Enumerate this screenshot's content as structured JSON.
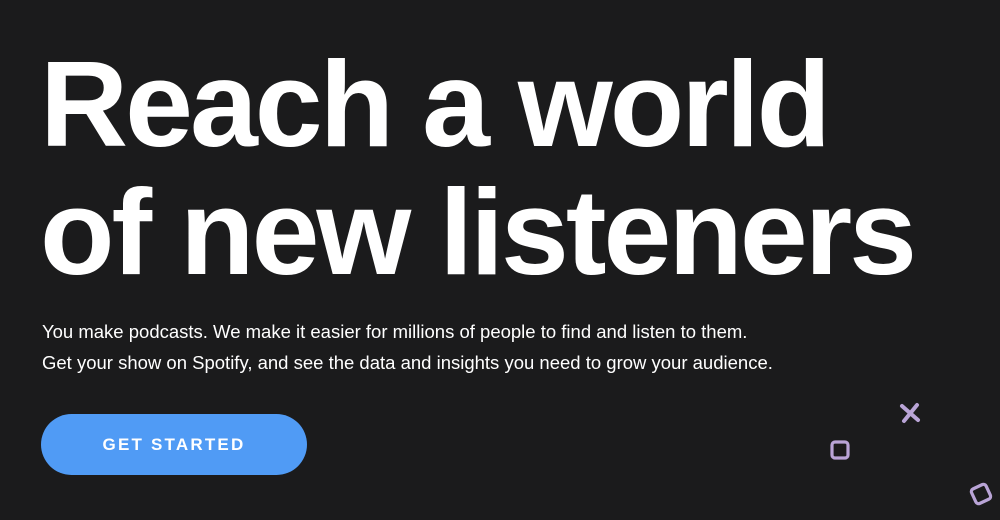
{
  "hero": {
    "headline_line1": "Reach a world",
    "headline_line2": "of new listeners",
    "subtext_line1": "You make podcasts. We make it easier for millions of people to find and listen to them.",
    "subtext_line2": "Get your show on Spotify, and see the data and insights you need to grow your audience.",
    "cta_label": "GET STARTED"
  },
  "colors": {
    "background": "#1b1b1c",
    "text": "#ffffff",
    "button": "#509bf5",
    "decoration": "#b9a4d6"
  },
  "icons": {
    "decor_1": "x-mark-icon",
    "decor_2": "square-outline-icon",
    "decor_3": "square-outline-icon"
  }
}
